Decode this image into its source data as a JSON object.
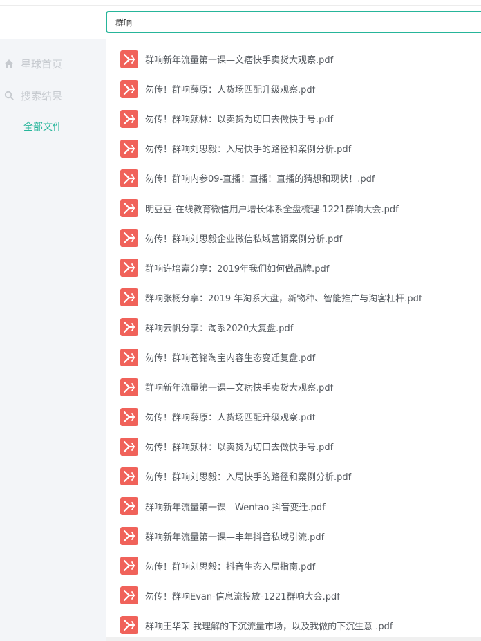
{
  "search": {
    "value": "群响",
    "accent_color": "#26b59a"
  },
  "sidebar": {
    "items": [
      {
        "label": "星球首页",
        "icon": "home-icon"
      },
      {
        "label": "搜索结果",
        "icon": "search-icon"
      },
      {
        "label": "全部文件",
        "icon": ""
      }
    ],
    "active_color": "#26b59a",
    "inactive_color": "#c6cacf"
  },
  "files": {
    "icon": "pdf-icon",
    "icon_color": "#f0625a",
    "items": [
      "群响新年流量第一课—文痞快手卖货大观察.pdf",
      "勿传！群响薛原：人货场匹配升级观察.pdf",
      "勿传！群响颜林：以卖货为切口去做快手号.pdf",
      "勿传！群响刘思毅：入局快手的路径和案例分析.pdf",
      "勿传！群响内参09-直播！直播！直播的猜想和现状！.pdf",
      "明豆豆-在线教育微信用户增长体系全盘梳理-1221群响大会.pdf",
      "勿传！群响刘思毅企业微信私域营销案例分析.pdf",
      "群响许培嘉分享：2019年我们如何做品牌.pdf",
      "群响张杨分享：2019 年淘系大盘，新物种、智能推广与淘客杠杆.pdf",
      "群响云帆分享：淘系2020大复盘.pdf",
      "勿传！群响苍铭淘宝内容生态变迁复盘.pdf",
      "群响新年流量第一课—文痞快手卖货大观察.pdf",
      "勿传！群响薛原：人货场匹配升级观察.pdf",
      "勿传！群响颜林：以卖货为切口去做快手号.pdf",
      "勿传！群响刘思毅：入局快手的路径和案例分析.pdf",
      "群响新年流量第一课—Wentao 抖音变迁.pdf",
      "群响新年流量第一课—丰年抖音私域引流.pdf",
      "勿传！群响刘思毅：抖音生态入局指南.pdf",
      "勿传！群响Evan-信息流投放-1221群响大会.pdf",
      "群响王华荣 我理解的下沉流量市场，以及我做的下沉生意 .pdf"
    ]
  }
}
